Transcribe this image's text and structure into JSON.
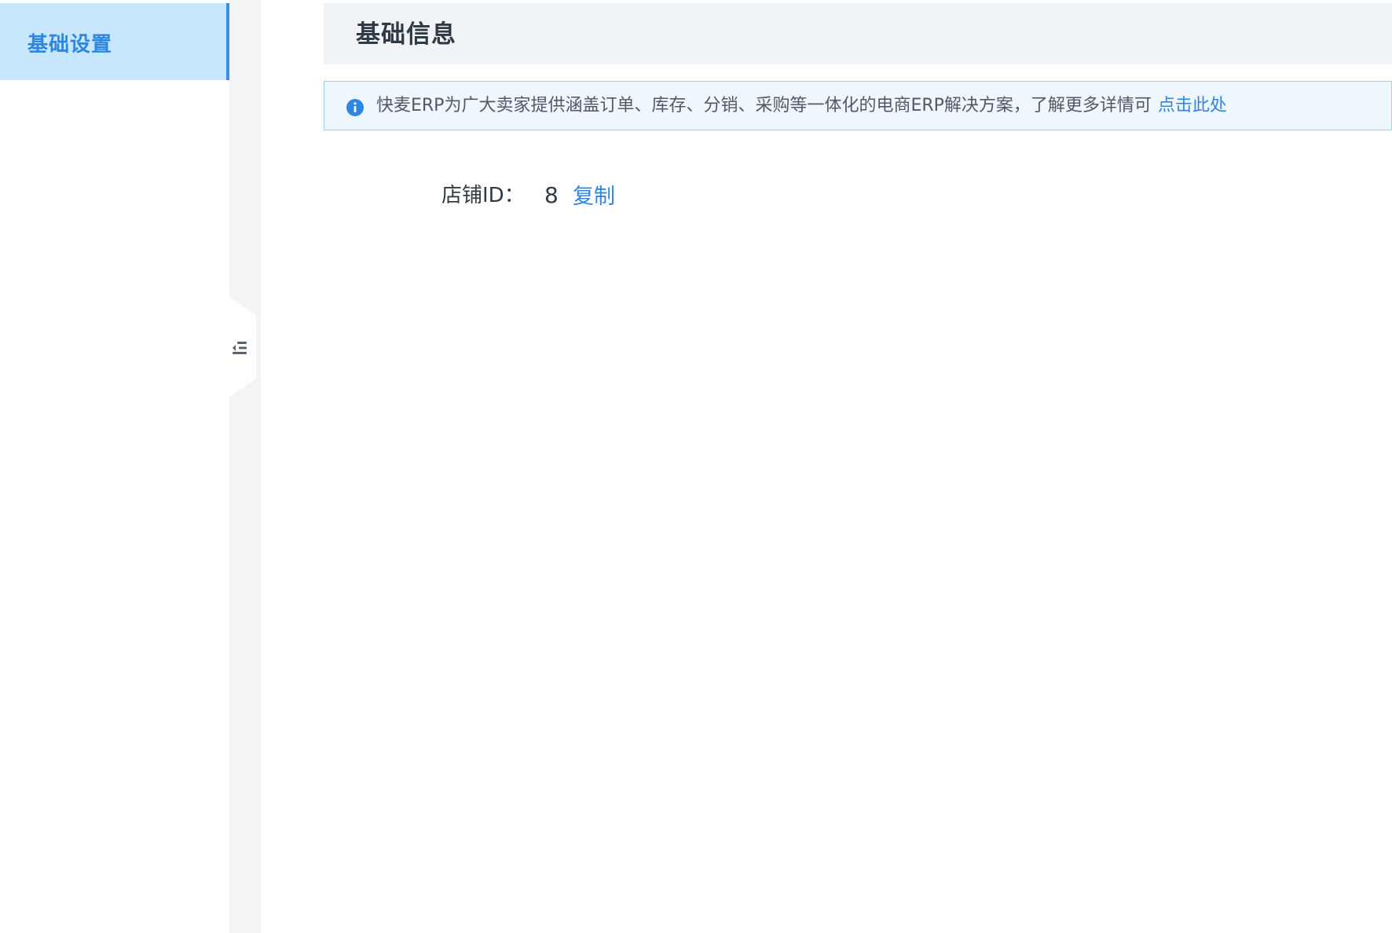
{
  "sidebar": {
    "items": [
      {
        "label": "基础设置",
        "active": true
      }
    ]
  },
  "main": {
    "section_title": "基础信息",
    "info_bar": {
      "text": "快麦ERP为广大卖家提供涵盖订单、库存、分销、采购等一体化的电商ERP解决方案，了解更多详情可",
      "link_label": "点击此处"
    },
    "store_id": {
      "label": "店铺ID：",
      "value": "8",
      "copy_label": "复制"
    }
  },
  "colors": {
    "accent": "#2f86e0",
    "sidebar_active_bg": "#c9e7fc",
    "header_bg": "#f1f4f7",
    "info_bg": "#eef7fe",
    "info_border": "#9ccdf6",
    "text_dark": "#303a45"
  },
  "icons": {
    "info": "info-icon",
    "collapse": "collapse-menu-icon"
  }
}
